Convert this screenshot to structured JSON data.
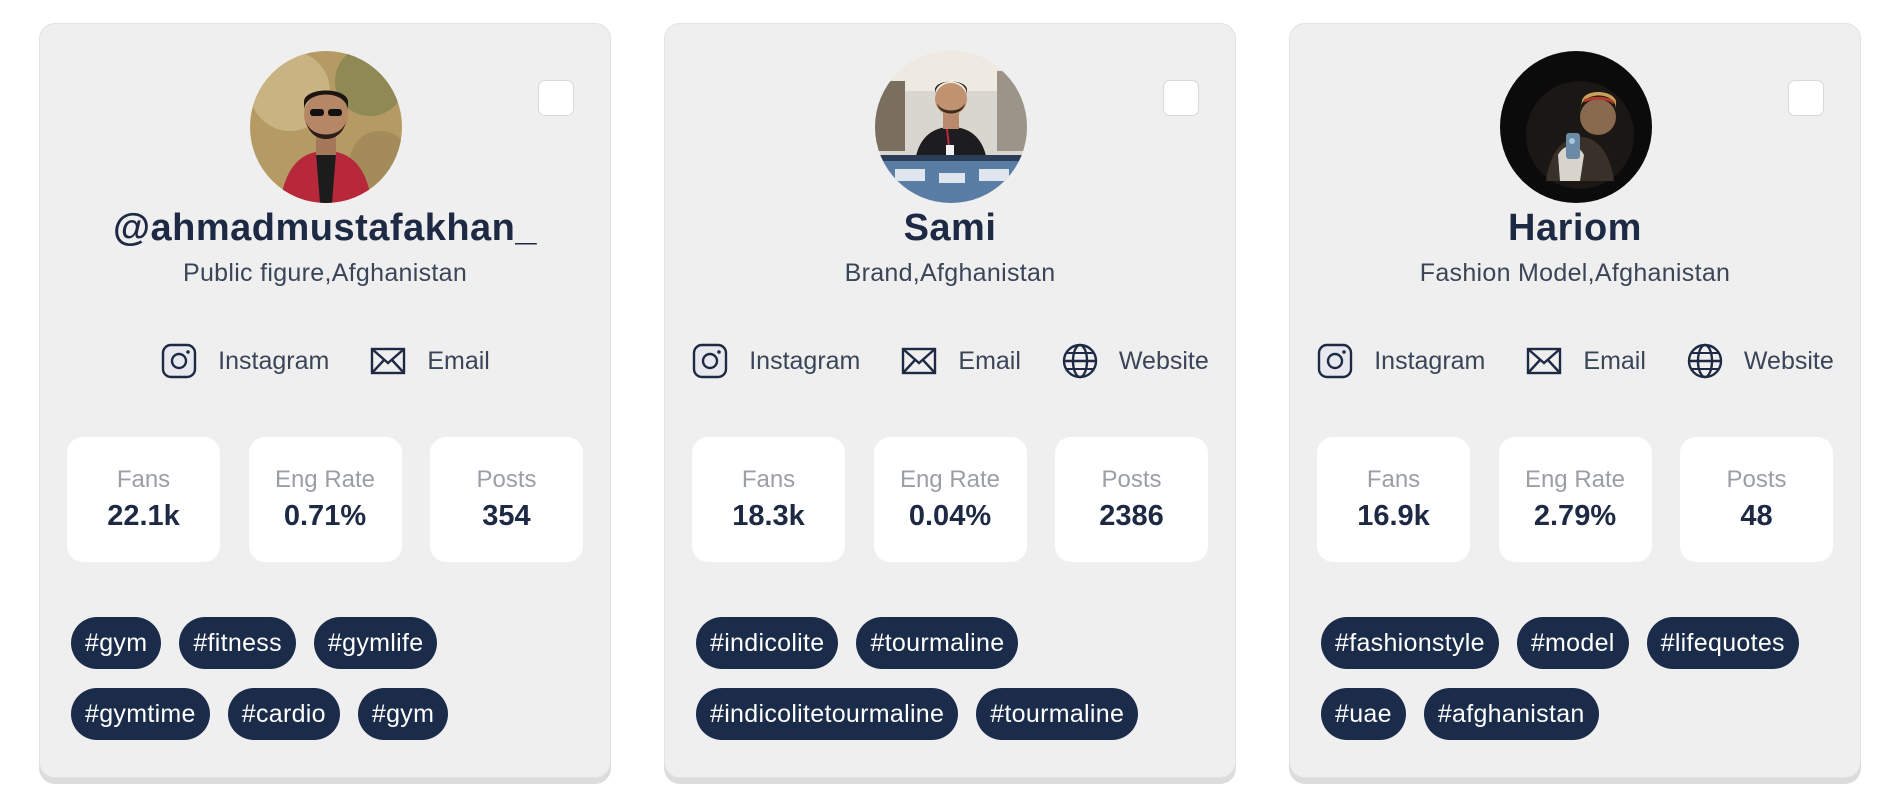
{
  "cards": [
    {
      "name": "@ahmadmustafakhan_",
      "category": "Public figure,Afghanistan",
      "links": {
        "instagram": "Instagram",
        "email": "Email"
      },
      "stats": {
        "fans_label": "Fans",
        "fans": "22.1k",
        "eng_label": "Eng Rate",
        "eng": "0.71%",
        "posts_label": "Posts",
        "posts": "354"
      },
      "tags": [
        "#gym",
        "#fitness",
        "#gymlife",
        "#gymtime",
        "#cardio",
        "#gym"
      ]
    },
    {
      "name": "Sami",
      "category": "Brand,Afghanistan",
      "links": {
        "instagram": "Instagram",
        "email": "Email",
        "website": "Website"
      },
      "stats": {
        "fans_label": "Fans",
        "fans": "18.3k",
        "eng_label": "Eng Rate",
        "eng": "0.04%",
        "posts_label": "Posts",
        "posts": "2386"
      },
      "tags": [
        "#indicolite",
        "#tourmaline",
        "#indicolitetourmaline",
        "#tourmaline"
      ]
    },
    {
      "name": "Hariom",
      "category": "Fashion Model,Afghanistan",
      "links": {
        "instagram": "Instagram",
        "email": "Email",
        "website": "Website"
      },
      "stats": {
        "fans_label": "Fans",
        "fans": "16.9k",
        "eng_label": "Eng Rate",
        "eng": "2.79%",
        "posts_label": "Posts",
        "posts": "48"
      },
      "tags": [
        "#fashionstyle",
        "#model",
        "#lifequotes",
        "#uae",
        "#afghanistan"
      ]
    }
  ],
  "icons": {
    "instagram": "instagram-icon",
    "email": "envelope-icon",
    "website": "globe-icon"
  },
  "colors": {
    "card_bg": "#efefef",
    "tag_bg": "#1b2c4a",
    "text_primary": "#1e2a44",
    "text_muted": "#9a9ea6"
  }
}
